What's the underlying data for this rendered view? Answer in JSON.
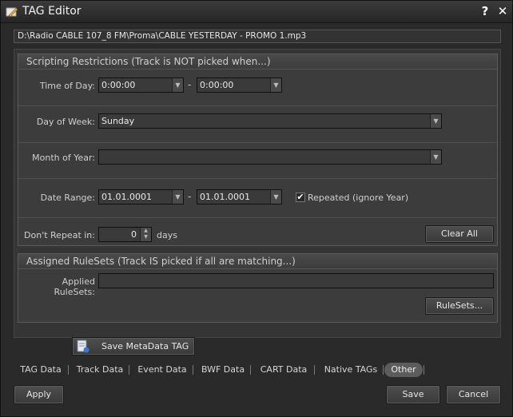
{
  "window": {
    "title": "TAG Editor",
    "help_label": "?",
    "close_label": "✕"
  },
  "file_path": "D:\\Radio CABLE 107_8 FM\\Proma\\CABLE YESTERDAY - PROMO 1.mp3",
  "restrictions": {
    "title": "Scripting Restrictions (Track is NOT picked when...)",
    "time_of_day": {
      "label": "Time of Day:",
      "from": "0:00:00",
      "to": "0:00:00",
      "sep": "-"
    },
    "day_of_week": {
      "label": "Day of Week:",
      "value": "Sunday"
    },
    "month_of_year": {
      "label": "Month of Year:",
      "value": ""
    },
    "date_range": {
      "label": "Date Range:",
      "from": "01.01.0001",
      "to": "01.01.0001",
      "sep": "-",
      "repeated_label": "Repeated (ignore Year)",
      "repeated_checked": true
    },
    "dont_repeat": {
      "label": "Don't Repeat in:",
      "value": "0",
      "unit": "days"
    },
    "clear_all_label": "Clear All"
  },
  "rulesets": {
    "title": "Assigned RuleSets (Track IS picked if all are matching...)",
    "applied_label": "Applied RuleSets:",
    "applied_value": "",
    "button_label": "RuleSets..."
  },
  "save_metadata_label": "Save MetaData TAG",
  "tabs": [
    {
      "label": "TAG Data",
      "active": false
    },
    {
      "label": "Track Data",
      "active": false
    },
    {
      "label": "Event Data",
      "active": false
    },
    {
      "label": "BWF Data",
      "active": false
    },
    {
      "label": "CART Data",
      "active": false
    },
    {
      "label": "Native TAGs",
      "active": false
    },
    {
      "label": "Other",
      "active": true
    }
  ],
  "footer": {
    "apply_label": "Apply",
    "save_label": "Save",
    "cancel_label": "Cancel"
  },
  "icons": {
    "app": "pencil-tag-icon",
    "dropdown": "chevron-down-icon",
    "check": "check-icon",
    "save_meta": "document-save-icon"
  }
}
